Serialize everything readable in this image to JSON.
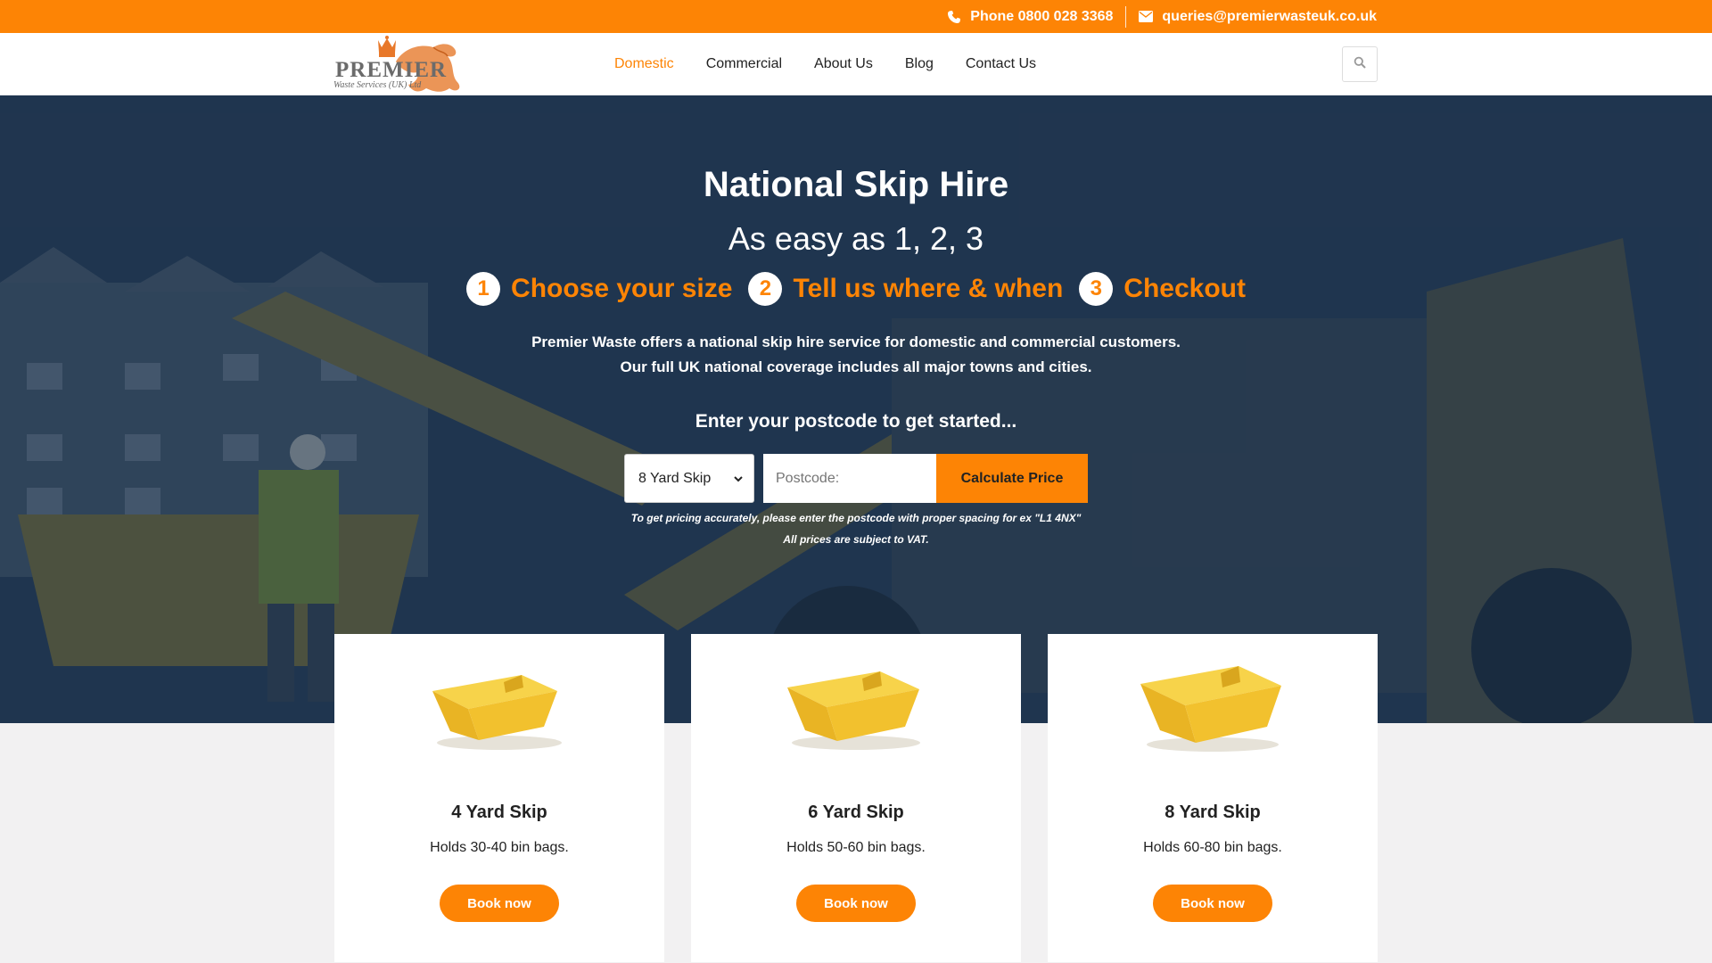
{
  "topbar": {
    "phone_label": "Phone 0800 028 3368",
    "email_label": "queries@premierwasteuk.co.uk",
    "phone_icon": "phone-icon",
    "email_icon": "envelope-icon"
  },
  "header": {
    "logo_word": "PREMIER",
    "logo_sub": "Waste Services (UK) Ltd",
    "nav": [
      {
        "label": "Domestic"
      },
      {
        "label": "Commercial"
      },
      {
        "label": "About Us"
      },
      {
        "label": "Blog"
      },
      {
        "label": "Contact Us"
      }
    ],
    "search_icon": "search-icon"
  },
  "hero": {
    "title": "National Skip Hire",
    "subtitle": "As easy as 1, 2, 3",
    "steps": [
      {
        "num": "1",
        "label": "Choose your size"
      },
      {
        "num": "2",
        "label": "Tell us where & when"
      },
      {
        "num": "3",
        "label": "Checkout"
      }
    ],
    "intro_line1": "Premier Waste offers a national skip hire service for domestic and commercial customers.",
    "intro_line2": "Our full UK national coverage includes all major towns and cities.",
    "prompt": "Enter your postcode to get started...",
    "form": {
      "skip_select_value": "8 Yard Skip",
      "postcode_placeholder": "Postcode:",
      "calculate_label": "Calculate Price"
    },
    "note_line1": "To get pricing accurately, please enter the postcode with proper spacing for ex \"L1 4NX\"",
    "note_line2": "All prices are subject to VAT."
  },
  "cards": [
    {
      "title": "4 Yard Skip",
      "desc": "Holds 30-40 bin bags.",
      "button": "Book now"
    },
    {
      "title": "6 Yard Skip",
      "desc": "Holds 50-60 bin bags.",
      "button": "Book now"
    },
    {
      "title": "8 Yard Skip",
      "desc": "Holds 60-80 bin bags.",
      "button": "Book now"
    }
  ],
  "colors": {
    "accent": "#fd8405",
    "hero_overlay": "#162d4a",
    "page_bg": "#f2f1f2",
    "skip_yellow": "#f2c12e"
  }
}
